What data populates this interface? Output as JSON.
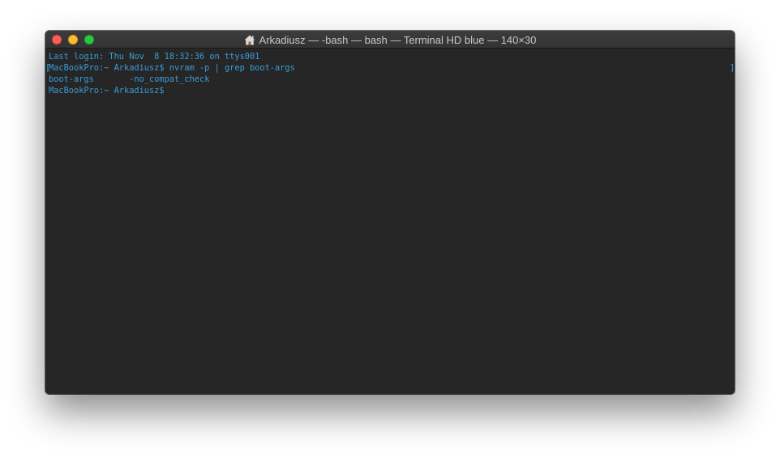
{
  "window": {
    "title": "Arkadiusz — -bash — bash — Terminal HD blue — 140×30",
    "title_icon": "home-icon",
    "colors": {
      "background": "#262626",
      "titlebar": "#383838",
      "text": "#3a9cd6",
      "close": "#fc5f57",
      "minimize": "#fdbc2e",
      "zoom": "#28c840"
    }
  },
  "terminal": {
    "lines": [
      "Last login: Thu Nov  8 18:32:36 on ttys001",
      "MacBookPro:~ Arkadiusz$ nvram -p | grep boot-args",
      "boot-args\t-no_compat_check",
      "MacBookPro:~ Arkadiusz$ "
    ],
    "selection_bracket_left": "[",
    "selection_bracket_right": "]"
  }
}
